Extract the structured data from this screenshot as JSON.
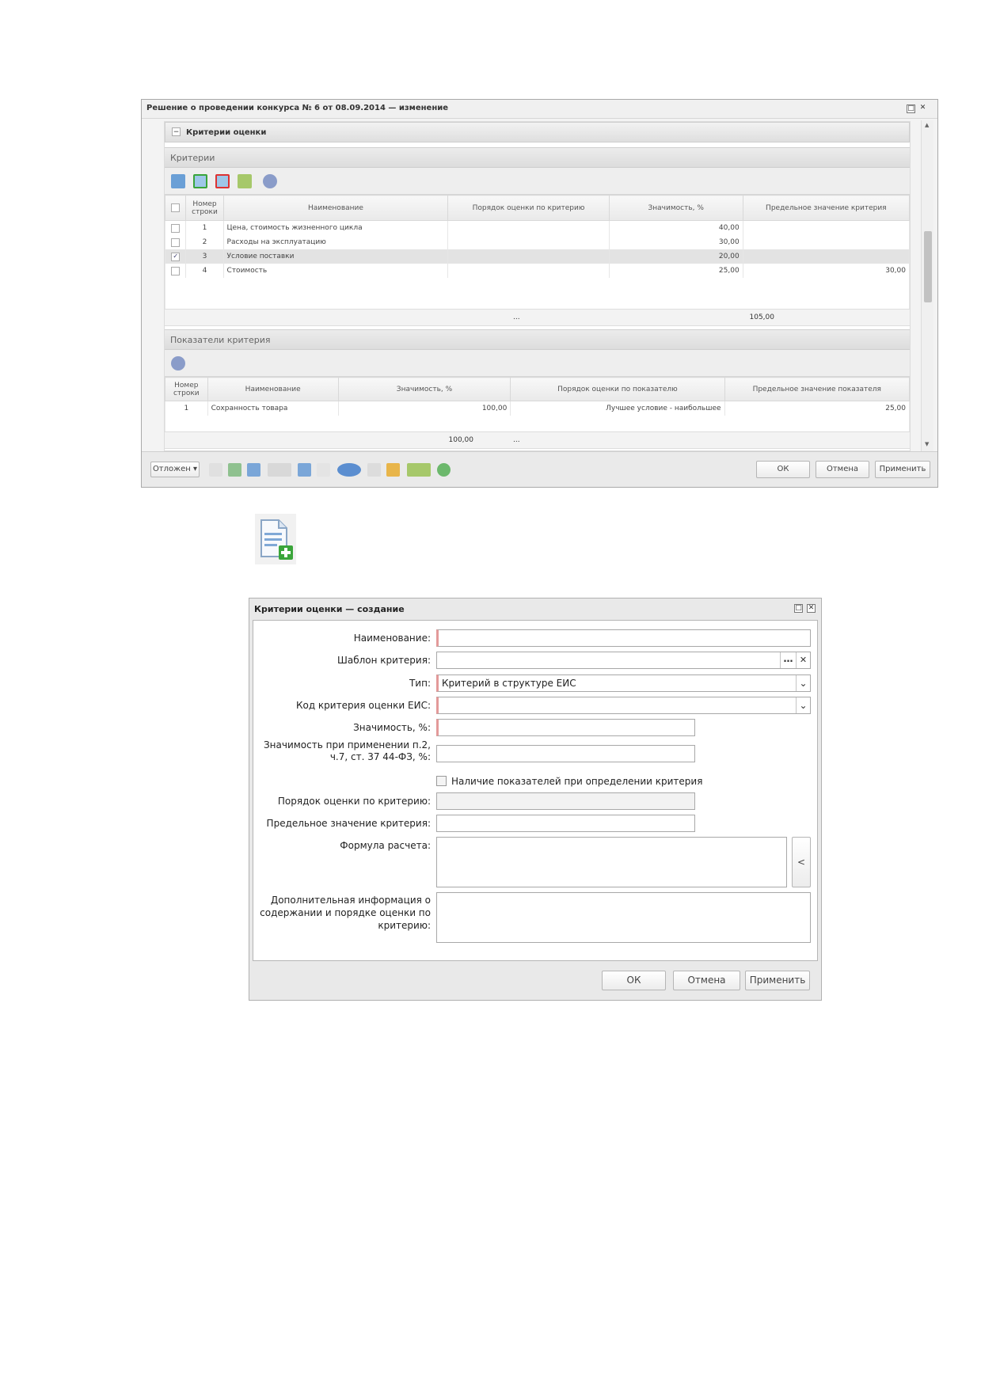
{
  "window1": {
    "title": "Решение о проведении конкурса № 6 от 08.09.2014 — изменение",
    "section_title": "Критерии оценки",
    "criteria_group": "Критерии",
    "criteria_columns": [
      "Номер строки",
      "Наименование",
      "Порядок оценки по критерию",
      "Значимость, %",
      "Предельное значение критерия"
    ],
    "criteria_rows": [
      {
        "num": "1",
        "name": "Цена, стоимость жизненного цикла",
        "order": "",
        "weight": "40,00",
        "limit": "",
        "checked": false
      },
      {
        "num": "2",
        "name": "Расходы на эксплуатацию",
        "order": "",
        "weight": "30,00",
        "limit": "",
        "checked": false
      },
      {
        "num": "3",
        "name": "Условие поставки",
        "order": "",
        "weight": "20,00",
        "limit": "",
        "checked": true
      },
      {
        "num": "4",
        "name": "Стоимость",
        "order": "",
        "weight": "25,00",
        "limit": "30,00",
        "checked": false
      }
    ],
    "criteria_footer": {
      "dots": "...",
      "total": "105,00"
    },
    "indicators_group": "Показатели критерия",
    "indicator_columns": [
      "Номер строки",
      "Наименование",
      "Значимость, %",
      "Порядок оценки по показателю",
      "Предельное значение показателя"
    ],
    "indicator_rows": [
      {
        "num": "1",
        "name": "Сохранность товара",
        "weight": "100,00",
        "order": "Лучшее условие - наибольшее",
        "limit": "25,00"
      }
    ],
    "indicator_footer": {
      "total": "100,00",
      "dots": "..."
    },
    "toolbar_left": "Отложен",
    "ok": "ОК",
    "cancel": "Отмена",
    "apply": "Применить"
  },
  "dialog": {
    "title": "Критерии оценки — создание",
    "name_label": "Наименование:",
    "template_label": "Шаблон критерия:",
    "type_label": "Тип:",
    "type_value": "Критерий в структуре ЕИС",
    "eis_code_label": "Код критерия оценки ЕИС:",
    "weight_label": "Значимость, %:",
    "weight2_label_line1": "Значимость при применении п.2,",
    "weight2_label_line2": "ч.7, ст. 37 44-ФЗ, %:",
    "indicators_checkbox": "Наличие показателей при определении критерия",
    "order_label": "Порядок оценки по критерию:",
    "limit_label": "Предельное значение критерия:",
    "formula_label": "Формула расчета:",
    "formula_btn": "<",
    "info_label_line1": "Дополнительная информация о",
    "info_label_line2": "содержании и порядке оценки по",
    "info_label_line3": "критерию:",
    "ok": "ОК",
    "cancel": "Отмена",
    "apply": "Применить"
  },
  "colors": {
    "required": "#e39a9a",
    "selected_row": "#e3e3e3",
    "icon_green": "#3aa53a"
  }
}
